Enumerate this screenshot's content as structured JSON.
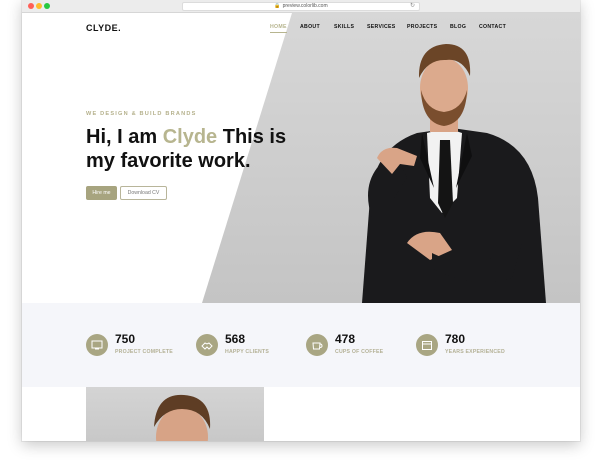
{
  "browser": {
    "url": "preview.colorlib.com"
  },
  "site": {
    "logo": "CLYDE.",
    "nav": [
      "HOME",
      "ABOUT",
      "SKILLS",
      "SERVICES",
      "PROJECTS",
      "BLOG",
      "CONTACT"
    ],
    "active_nav": "HOME"
  },
  "hero": {
    "tagline": "WE DESIGN & BUILD BRANDS",
    "headline_pre": "Hi, I am ",
    "headline_accent": "Clyde",
    "headline_post": " This is my favorite work.",
    "hire_button": "Hire me",
    "download_button": "Download CV"
  },
  "stats": [
    {
      "value": "750",
      "label": "PROJECT COMPLETE",
      "icon": "monitor-icon"
    },
    {
      "value": "568",
      "label": "HAPPY CLIENTS",
      "icon": "handshake-icon"
    },
    {
      "value": "478",
      "label": "CUPS OF COFFEE",
      "icon": "coffee-icon"
    },
    {
      "value": "780",
      "label": "YEARS EXPERIENCED",
      "icon": "calendar-icon"
    }
  ],
  "colors": {
    "accent": "#b7b58f",
    "stats_bg": "#f5f6fa",
    "dark": "#111111"
  }
}
